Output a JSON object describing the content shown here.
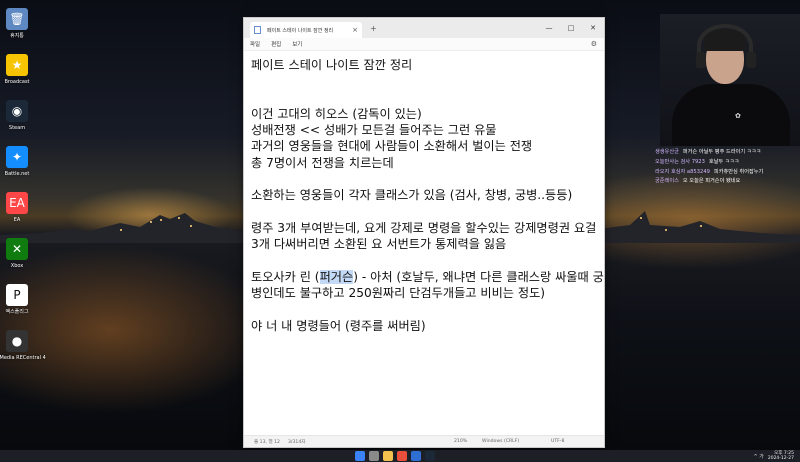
{
  "desktop": {
    "icons": [
      {
        "label": "휴지통",
        "icon": "recycle-bin-icon",
        "color": "#5e88c2",
        "glyph": "🗑"
      },
      {
        "label": "Broadcast",
        "icon": "star-icon",
        "color": "#f6c400",
        "glyph": "★"
      },
      {
        "label": "Steam",
        "icon": "steam-icon",
        "color": "#1b2838",
        "glyph": "◉"
      },
      {
        "label": "Battle.net",
        "icon": "battlenet-icon",
        "color": "#148eff",
        "glyph": "✦"
      },
      {
        "label": "EA",
        "icon": "ea-icon",
        "color": "#ff4747",
        "glyph": "EA"
      },
      {
        "label": "Xbox",
        "icon": "xbox-icon",
        "color": "#107c10",
        "glyph": "✕"
      },
      {
        "label": "엑스플리그",
        "icon": "pmang-icon",
        "color": "#ffffff",
        "glyph": "P"
      },
      {
        "label": "AVerMedia RECentral 4",
        "icon": "avermedia-icon",
        "color": "#333333",
        "glyph": "●"
      }
    ]
  },
  "notepad": {
    "tab_title": "페이트 스테이 나이트 잠깐 정리",
    "tab_close": "×",
    "new_tab": "+",
    "controls": {
      "minimize": "—",
      "maximize": "□",
      "close": "✕"
    },
    "menu": {
      "file": "파일",
      "edit": "편집",
      "view": "보기"
    },
    "settings_icon": "⚙",
    "text": {
      "before_sel": "페이트 스테이 나이트 잠깐 정리\n\n\n이건 고대의 히오스 (감독이 있는)\n성배전쟁 << 성배가 모든걸 들어주는 그런 유물\n과거의 영웅들을 현대에 사람들이 소환해서 벌이는 전쟁\n총 7명이서 전쟁을 치르는데\n\n소환하는 영웅들이 각자 클래스가 있음 (검사, 창병, 궁병..등등)\n\n령주 3개 부여받는데, 요게 강제로 명령을 할수있는 강제명령권 요걸 3개 다써버리면 소환된 요 서번트가 통제력을 잃음\n\n토오사카 린 (",
      "selected": "퍼거슨",
      "after_sel": ") - 아처 (호날두, 왜냐면 다른 클래스랑 싸울때 궁병인데도 불구하고 250원짜리 단검두개들고 비비는 정도)\n\n야 너 내 명령들어 (령주를 써버림)"
    },
    "status": {
      "position": "줄 13, 열 12",
      "chars": "3/314자",
      "zoom": "210%",
      "eol": "Windows (CRLF)",
      "encoding": "UTF-8"
    }
  },
  "stream_chat": [
    {
      "user": "생생유산균",
      "message": "퍼거슨 아닐두 평주 드라이기 ㅋㅋㅋ"
    },
    {
      "user": "오늘만사는 검사 7923",
      "message": "호날두 ㅋㅋㅋ"
    },
    {
      "user": "라오지 호심자 a853249",
      "message": "피카츄만심 취어잡누기"
    },
    {
      "user": "궁준레이스",
      "message": "오 오늘은 피거슨이 됐네요"
    }
  ],
  "taskbar": {
    "tray_lang": "^ 가",
    "time": "오후 7:25",
    "date": "2024-12-27"
  },
  "colors": {
    "selection": "#c4d9f5",
    "chat_username": "#d4b7ff"
  }
}
